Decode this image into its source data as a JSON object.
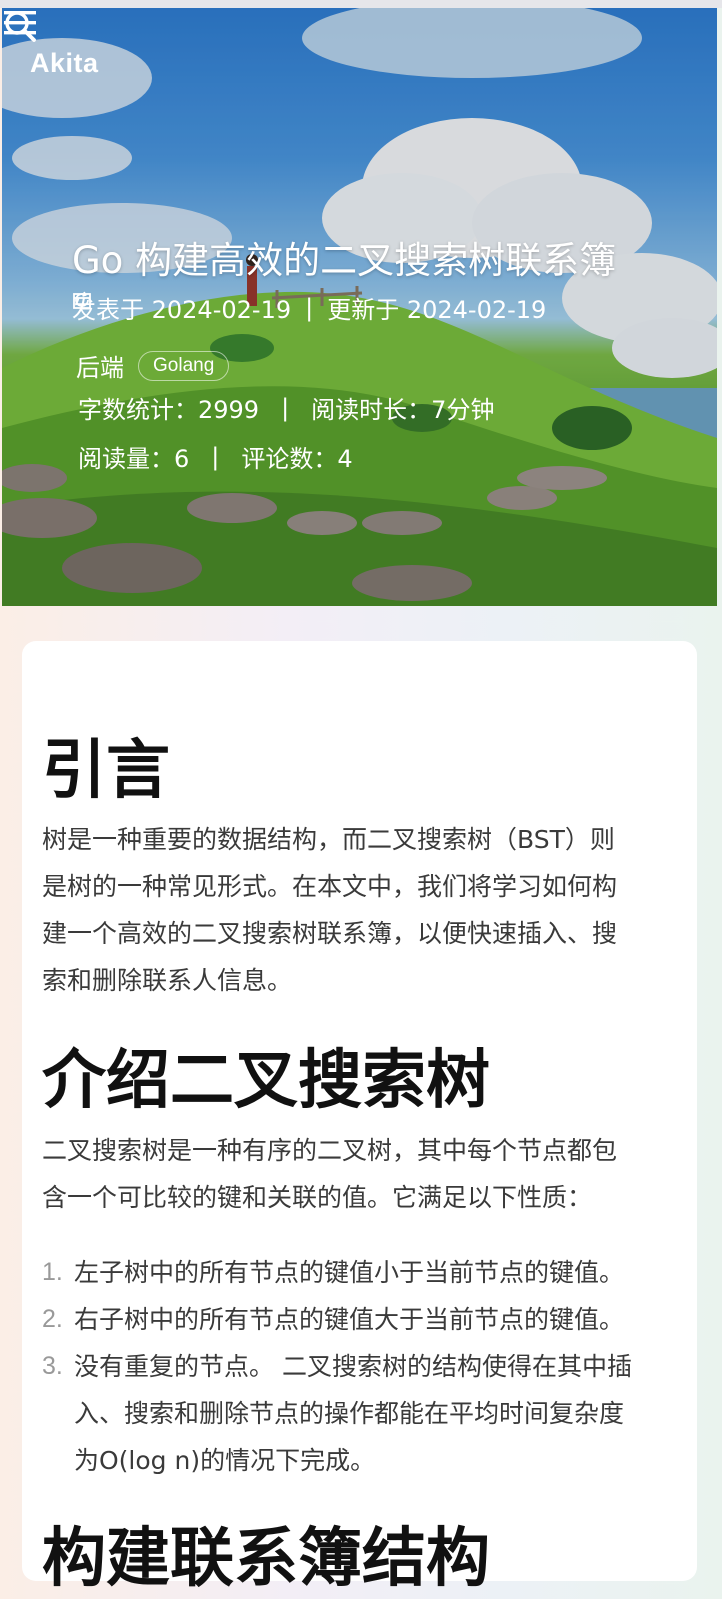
{
  "header": {
    "brand": "Akita",
    "search_icon": "search-icon",
    "menu_icon": "menu-icon"
  },
  "post": {
    "title": "Go 构建高效的二叉搜索树联系簿",
    "published": "发表于 2024-02-19",
    "updated": "更新于 2024-02-19",
    "category": "后端",
    "tag": "Golang",
    "word_count": "字数统计：2999",
    "reading_time": "阅读时长：7分钟",
    "views": "阅读量：6",
    "comments": "评论数：4",
    "separator": "|"
  },
  "content": {
    "h_intro": "引言",
    "p_intro_lines": [
      "树是一种重要的数据结构，而二叉搜索树（BST）则",
      "是树的一种常见形式。在本文中，我们将学习如何构",
      "建一个高效的二叉搜索树联系簿，以便快速插入、搜",
      "索和删除联系人信息。"
    ],
    "h_bst": "介绍二叉搜索树",
    "p_bst_lines": [
      "二叉搜索树是一种有序的二叉树，其中每个节点都包",
      "含一个可比较的键和关联的值。它满足以下性质："
    ],
    "list": [
      {
        "num": "1.",
        "lines": [
          "左子树中的所有节点的键值小于当前节点的键值。"
        ]
      },
      {
        "num": "2.",
        "lines": [
          "右子树中的所有节点的键值大于当前节点的键值。"
        ]
      },
      {
        "num": "3.",
        "lines": [
          "没有重复的节点。 二叉搜索树的结构使得在其中插",
          "入、搜索和删除节点的操作都能在平均时间复杂度",
          "为O(log n)的情况下完成。"
        ]
      }
    ],
    "h_struct": "构建联系簿结构"
  }
}
